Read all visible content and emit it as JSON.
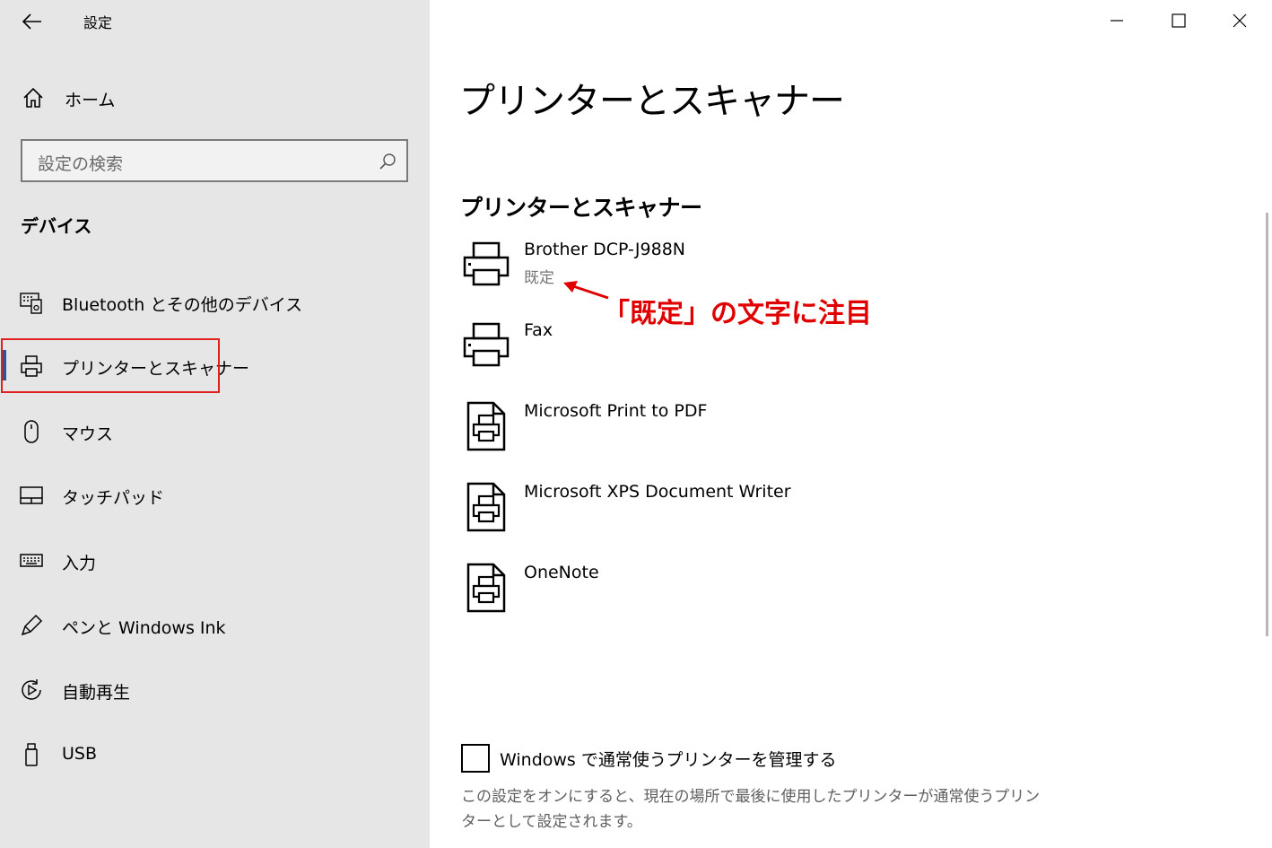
{
  "window": {
    "title": "設定",
    "controls": {
      "minimize": "minimize-icon",
      "maximize": "maximize-icon",
      "close": "close-icon"
    }
  },
  "sidebar": {
    "home_label": "ホーム",
    "search_placeholder": "設定の検索",
    "section_title": "デバイス",
    "items": [
      {
        "label": "Bluetooth とその他のデバイス",
        "icon": "bluetooth-devices-icon"
      },
      {
        "label": "プリンターとスキャナー",
        "icon": "printer-icon",
        "active": true
      },
      {
        "label": "マウス",
        "icon": "mouse-icon"
      },
      {
        "label": "タッチパッド",
        "icon": "touchpad-icon"
      },
      {
        "label": "入力",
        "icon": "keyboard-icon"
      },
      {
        "label": "ペンと Windows Ink",
        "icon": "pen-icon"
      },
      {
        "label": "自動再生",
        "icon": "autoplay-icon"
      },
      {
        "label": "USB",
        "icon": "usb-icon"
      }
    ]
  },
  "main": {
    "page_title": "プリンターとスキャナー",
    "section_title": "プリンターとスキャナー",
    "printers": [
      {
        "name": "Brother DCP-J988N",
        "status": "既定",
        "icon": "printer-icon"
      },
      {
        "name": "Fax",
        "status": "",
        "icon": "printer-icon"
      },
      {
        "name": "Microsoft Print to PDF",
        "status": "",
        "icon": "virtual-printer-icon"
      },
      {
        "name": "Microsoft XPS Document Writer",
        "status": "",
        "icon": "virtual-printer-icon"
      },
      {
        "name": "OneNote",
        "status": "",
        "icon": "virtual-printer-icon"
      }
    ],
    "annotation": "「既定」の文字に注目",
    "manage_checkbox": {
      "label": "Windows で通常使うプリンターを管理する",
      "checked": false
    },
    "description_line1": "この設定をオンにすると、現在の場所で最後に使用したプリンターが通常使うプリン",
    "description_line2": "ターとして設定されます。"
  },
  "colors": {
    "sidebar_bg": "#e6e6e6",
    "accent": "#2b5797",
    "highlight": "#e02020"
  }
}
